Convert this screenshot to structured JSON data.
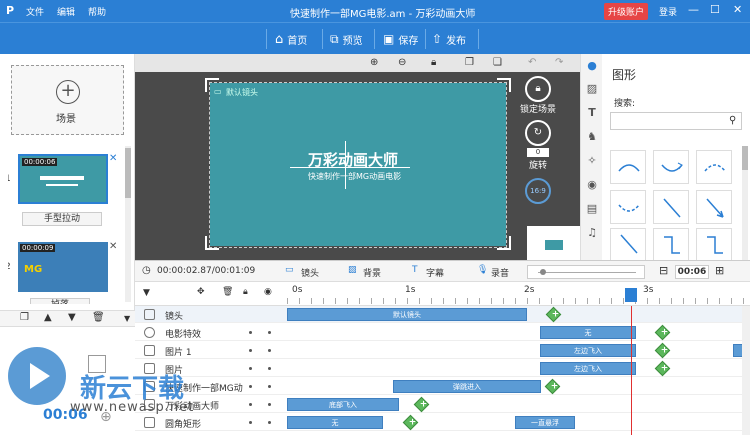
{
  "titlebar": {
    "logo": "P",
    "menu": [
      "文件",
      "编辑",
      "帮助"
    ],
    "title": "快速制作一部MG电影.am - 万彩动画大师",
    "upgrade": "升级账户",
    "login": "登录"
  },
  "toolbar": {
    "home": "首页",
    "preview": "预览",
    "save": "保存",
    "publish": "发布"
  },
  "left": {
    "add_scene": "场景",
    "scenes": [
      {
        "num": "1",
        "time": "00:00:06",
        "transition": "手型拉动"
      },
      {
        "num": "2",
        "time": "00:00:09",
        "transition": "掉落",
        "thumb_text": "MG"
      }
    ],
    "playback_time": "00:06"
  },
  "canvas": {
    "camera_label": "默认镜头",
    "title_text": "万彩动画大师",
    "subtitle_text": "快速制作一部MG动画电影",
    "lock_label": "锁定场景",
    "rotate_label": "旋转",
    "rotate_value": "0",
    "zoom_value": "16:9"
  },
  "rightpanel": {
    "title": "图形",
    "search_label": "搜索:",
    "search_placeholder": ""
  },
  "timeline": {
    "current_time": "00:00:02.87/00:01:09",
    "tabs": [
      "镜头",
      "背景",
      "字幕",
      "录音"
    ],
    "duration": "00:06",
    "ruler": [
      "0s",
      "1s",
      "2s",
      "3s"
    ],
    "tracks": [
      {
        "name": "镜头",
        "bar": "默认镜头"
      },
      {
        "name": "电影特效",
        "bar": "无"
      },
      {
        "name": "图片 1",
        "bar": "左边飞入"
      },
      {
        "name": "图片",
        "bar": "左边飞入"
      },
      {
        "name": "快速制作一部MG动",
        "bar": "弹跳进入"
      },
      {
        "name": "万彩动画大师",
        "bar": "底部飞入"
      },
      {
        "name": "圆角矩形",
        "bar": "无",
        "bar2": "一直悬浮"
      }
    ]
  },
  "watermark": {
    "brand": "新云下载",
    "url": "www.newasp.net"
  },
  "colors": {
    "primary": "#2b7fd4",
    "upgrade": "#e64545",
    "canvas_teal": "#3e9aa5",
    "bar": "#5b9bd5",
    "keyframe": "#5cb85c",
    "playhead": "#e03030"
  }
}
